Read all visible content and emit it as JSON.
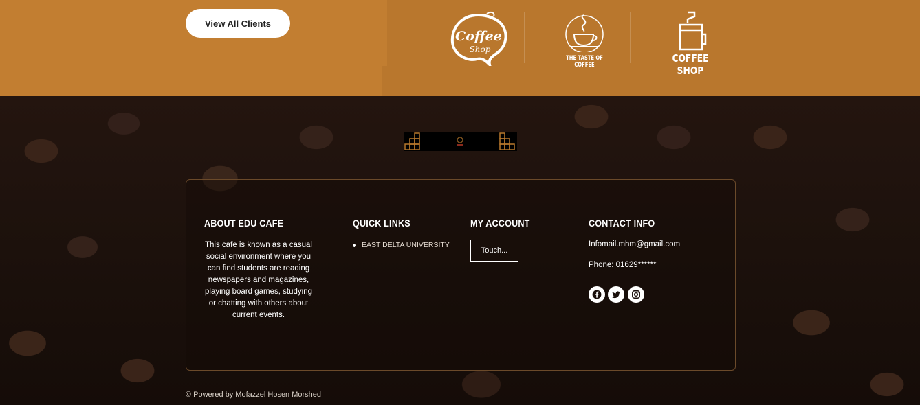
{
  "header": {
    "view_all_clients_label": "View All Clients",
    "logos": [
      {
        "name": "coffee-shop-script",
        "line1": "Coffee",
        "line2": "Shop"
      },
      {
        "name": "taste-of-coffee",
        "text": "THE TASTE OF COFFEE"
      },
      {
        "name": "coffee-shop-block",
        "text": "COFFEE SHOP"
      }
    ]
  },
  "footer": {
    "about": {
      "title": "ABOUT EDU CAFE",
      "text": "This cafe is known as a casual social environment where you can find students are reading newspapers and magazines, playing board games, studying or chatting with others about current events."
    },
    "quick_links": {
      "title": "QUICK LINKS",
      "items": [
        "EAST DELTA UNIVERSITY"
      ]
    },
    "my_account": {
      "title": "MY ACCOUNT",
      "button_label": "Touch..."
    },
    "contact": {
      "title": "CONTACT INFO",
      "email": "Infomail.mhm@gmail.com",
      "phone": "Phone: 01629******",
      "social": [
        "facebook-icon",
        "twitter-icon",
        "instagram-icon"
      ]
    },
    "copyright": "© Powered by Mofazzel Hosen Morshed"
  },
  "colors": {
    "accent": "#c27e31",
    "accent_dark": "#b9772d",
    "background": "#1a0f0b",
    "border": "#6b4a2a"
  }
}
